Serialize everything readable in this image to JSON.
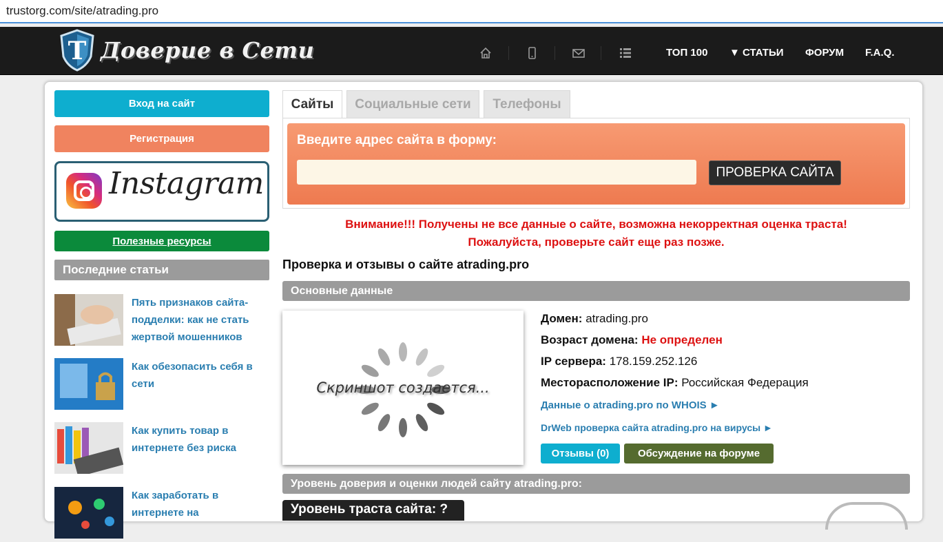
{
  "browser": {
    "url": "trustorg.com/site/atrading.pro"
  },
  "header": {
    "logo_text": "Доверие в Сети",
    "logo_letter": "T",
    "nav": [
      "ТОП 100",
      "▼ СТАТЬИ",
      "ФОРУМ",
      "F.A.Q."
    ],
    "icons": [
      "home-icon",
      "mobile-icon",
      "mail-icon",
      "list-icon"
    ],
    "background": "#1b1b1b"
  },
  "sidebar": {
    "login_label": "Вход на сайт",
    "register_label": "Регистрация",
    "instagram_label": "Instagram",
    "resources_label": "Полезные ресурсы",
    "latest_title": "Последние статьи",
    "articles": [
      {
        "title": "Пять признаков сайта-подделки: как не стать жертвой мошенников"
      },
      {
        "title": "Как обезопасить себя в сети"
      },
      {
        "title": "Как купить товар в интернете без риска"
      },
      {
        "title": "Как заработать в интернете на"
      }
    ],
    "colors": {
      "login": "#0eaecf",
      "register": "#f0835f",
      "resources": "#0b8a3b"
    }
  },
  "tabs": [
    {
      "label": "Сайты",
      "active": true
    },
    {
      "label": "Социальные сети",
      "active": false
    },
    {
      "label": "Телефоны",
      "active": false
    }
  ],
  "search_form": {
    "label": "Введите адрес сайта в форму:",
    "input_value": "",
    "button_label": "ПРОВЕРКА САЙТА"
  },
  "warning": {
    "line1": "Внимание!!! Получены не все данные о сайте, возможна некорректная оценка траста!",
    "line2": "Пожалуйста, проверьте сайт еще раз позже."
  },
  "check_title": "Проверка и отзывы о сайте atrading.pro",
  "basic_data": {
    "section_title": "Основные данные",
    "screenshot_text": "Скриншот создается...",
    "domain_label": "Домен:",
    "domain_value": "atrading.pro",
    "age_label": "Возраст домена:",
    "age_value": "Не определен",
    "ip_label": "IP сервера:",
    "ip_value": "178.159.252.126",
    "location_label": "Месторасположение IP:",
    "location_value": "Российская Федерация",
    "whois_link": "Данные о atrading.pro по WHOIS ►",
    "drweb_link": "DrWeb проверка сайта atrading.pro на вирусы ►",
    "reviews_button": "Отзывы (0)",
    "forum_button": "Обсуждение на форуме"
  },
  "trust": {
    "section_title": "Уровень доверия и оценки людей сайту atrading.pro:",
    "level_label": "Уровень траста сайта: ?"
  }
}
